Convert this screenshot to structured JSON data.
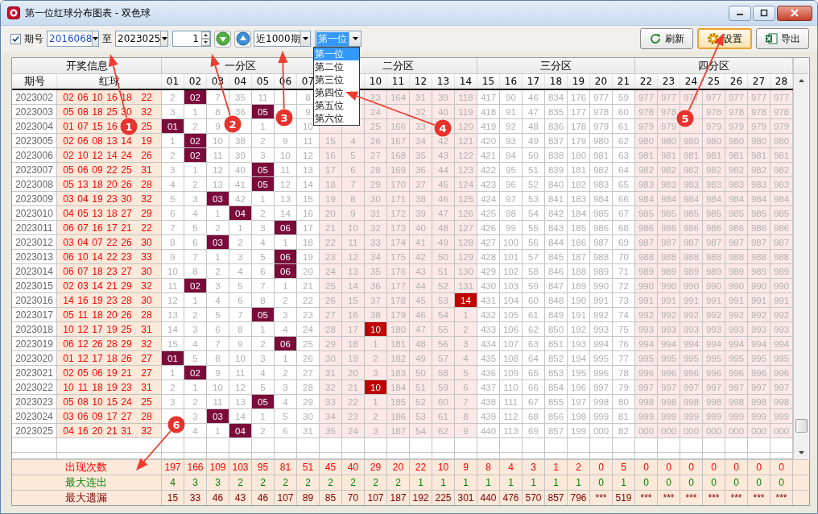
{
  "window": {
    "title": "第一位红球分布图表 - 双色球"
  },
  "toolbar": {
    "period_check": {
      "label": "期号",
      "checked": true
    },
    "from": "2016068",
    "to_label": "至",
    "to": "2023025",
    "step": "1",
    "range": "近1000期",
    "position": {
      "value": "第一位",
      "expanded": true,
      "options": [
        {
          "label": "第一位",
          "selected": true
        },
        {
          "label": "第二位",
          "selected": false
        },
        {
          "label": "第三位",
          "selected": false
        },
        {
          "label": "第四位",
          "selected": false
        },
        {
          "label": "第五位",
          "selected": false
        },
        {
          "label": "第六位",
          "selected": false
        }
      ]
    },
    "buttons": [
      {
        "label": "刷新",
        "kind": "refresh",
        "hovered": false
      },
      {
        "label": "设置",
        "kind": "settings",
        "hovered": true
      },
      {
        "label": "导出",
        "kind": "export",
        "hovered": false
      }
    ]
  },
  "table": {
    "info_header": "开奖信息",
    "issue_header": "期号",
    "red_header": "红球",
    "zones": [
      {
        "label": "一分区",
        "columns": [
          "01",
          "02",
          "03",
          "04",
          "05",
          "06",
          "07"
        ]
      },
      {
        "label": "二分区",
        "columns": [
          null,
          null,
          "10",
          "11",
          "12",
          "13",
          "14"
        ]
      },
      {
        "label": "三分区",
        "columns": [
          "15",
          "16",
          "17",
          "18",
          "19",
          "20",
          "21"
        ]
      },
      {
        "label": "四分区",
        "columns": [
          "22",
          "23",
          "24",
          "25",
          "26",
          "27",
          "28"
        ]
      }
    ],
    "rows": [
      {
        "issue": "2023002",
        "red": [
          "02",
          "06",
          "10",
          "16",
          "18",
          "22"
        ],
        "cells": [
          "2",
          "02",
          "7",
          "35",
          "11",
          null,
          "8",
          null,
          null,
          "23",
          "164",
          "31",
          "39",
          "118",
          "417",
          "90",
          "46",
          "834",
          "176",
          "977",
          "59",
          "977",
          "977",
          "977",
          "977",
          "977",
          "977",
          "977"
        ],
        "hit": [
          false,
          true,
          false,
          false,
          false,
          false,
          false,
          false,
          false,
          false,
          false,
          false,
          false,
          false,
          false,
          false,
          false,
          false,
          false,
          false,
          false,
          false,
          false,
          false,
          false,
          false,
          false,
          false
        ]
      },
      {
        "issue": "2023003",
        "red": [
          "05",
          "08",
          "18",
          "25",
          "30",
          "32"
        ],
        "cells": [
          "3",
          "1",
          "8",
          "36",
          "05",
          null,
          "9",
          null,
          null,
          "24",
          null,
          "32",
          "40",
          "119",
          "418",
          "91",
          "47",
          "835",
          "177",
          "978",
          "60",
          "978",
          "978",
          null,
          "978",
          "978",
          "978",
          "978"
        ],
        "hit": [
          false,
          false,
          false,
          false,
          true,
          false,
          false,
          false,
          false,
          false,
          false,
          false,
          false,
          false,
          false,
          false,
          false,
          false,
          false,
          false,
          false,
          false,
          false,
          false,
          false,
          false,
          false,
          false
        ]
      },
      {
        "issue": "2023004",
        "red": [
          "01",
          "07",
          "15",
          "16",
          "25"
        ],
        "cells": [
          "01",
          "2",
          "9",
          null,
          "1",
          null,
          "10",
          null,
          null,
          "25",
          "166",
          "33",
          null,
          "120",
          "419",
          "92",
          "48",
          "836",
          "178",
          "979",
          "61",
          "979",
          "979",
          null,
          "979",
          "979",
          "979",
          "979"
        ],
        "hit": [
          true,
          false,
          false,
          false,
          false,
          false,
          false,
          false,
          false,
          false,
          false,
          false,
          false,
          false,
          false,
          false,
          false,
          false,
          false,
          false,
          false,
          false,
          false,
          false,
          false,
          false,
          false,
          false
        ]
      },
      {
        "issue": "2023005",
        "red": [
          "02",
          "06",
          "08",
          "13",
          "14",
          "19"
        ],
        "cells": [
          "1",
          "02",
          "10",
          "38",
          "2",
          "9",
          "11",
          "15",
          "4",
          "26",
          "167",
          "34",
          "42",
          "121",
          "420",
          "93",
          "49",
          "837",
          "179",
          "980",
          "62",
          "980",
          "980",
          "980",
          "980",
          "980",
          "980",
          "980"
        ],
        "hit": [
          false,
          true,
          false,
          false,
          false,
          false,
          false,
          false,
          false,
          false,
          false,
          false,
          false,
          false,
          false,
          false,
          false,
          false,
          false,
          false,
          false,
          false,
          false,
          false,
          false,
          false,
          false,
          false
        ]
      },
      {
        "issue": "2023006",
        "red": [
          "02",
          "10",
          "12",
          "14",
          "24",
          "26"
        ],
        "cells": [
          "2",
          "02",
          "11",
          "39",
          "3",
          "10",
          "12",
          "16",
          "5",
          "27",
          "168",
          "35",
          "43",
          "122",
          "421",
          "94",
          "50",
          "838",
          "180",
          "981",
          "63",
          "981",
          "981",
          "981",
          "981",
          "981",
          "981",
          "981"
        ],
        "hit": [
          false,
          true,
          false,
          false,
          false,
          false,
          false,
          false,
          false,
          false,
          false,
          false,
          false,
          false,
          false,
          false,
          false,
          false,
          false,
          false,
          false,
          false,
          false,
          false,
          false,
          false,
          false,
          false
        ]
      },
      {
        "issue": "2023007",
        "red": [
          "05",
          "06",
          "09",
          "22",
          "25",
          "31"
        ],
        "cells": [
          "3",
          "1",
          "12",
          "40",
          "05",
          "11",
          "13",
          "17",
          "6",
          "28",
          "169",
          "36",
          "44",
          "123",
          "422",
          "95",
          "51",
          "839",
          "181",
          "982",
          "64",
          "982",
          "982",
          "982",
          "982",
          "982",
          "982",
          "982"
        ],
        "hit": [
          false,
          false,
          false,
          false,
          true,
          false,
          false,
          false,
          false,
          false,
          false,
          false,
          false,
          false,
          false,
          false,
          false,
          false,
          false,
          false,
          false,
          false,
          false,
          false,
          false,
          false,
          false,
          false
        ]
      },
      {
        "issue": "2023008",
        "red": [
          "05",
          "13",
          "18",
          "20",
          "26",
          "28"
        ],
        "cells": [
          "4",
          "2",
          "13",
          "41",
          "05",
          "12",
          "14",
          "18",
          "7",
          "29",
          "170",
          "37",
          "45",
          "124",
          "423",
          "96",
          "52",
          "840",
          "182",
          "983",
          "65",
          "983",
          "983",
          "983",
          "983",
          "983",
          "983",
          "983"
        ],
        "hit": [
          false,
          false,
          false,
          false,
          true,
          false,
          false,
          false,
          false,
          false,
          false,
          false,
          false,
          false,
          false,
          false,
          false,
          false,
          false,
          false,
          false,
          false,
          false,
          false,
          false,
          false,
          false,
          false
        ]
      },
      {
        "issue": "2023009",
        "red": [
          "03",
          "04",
          "19",
          "23",
          "30",
          "32"
        ],
        "cells": [
          "5",
          "3",
          "03",
          "42",
          "1",
          "13",
          "15",
          "19",
          "8",
          "30",
          "171",
          "38",
          "46",
          "125",
          "424",
          "97",
          "53",
          "841",
          "183",
          "984",
          "66",
          "984",
          "984",
          "984",
          "984",
          "984",
          "984",
          "984"
        ],
        "hit": [
          false,
          false,
          true,
          false,
          false,
          false,
          false,
          false,
          false,
          false,
          false,
          false,
          false,
          false,
          false,
          false,
          false,
          false,
          false,
          false,
          false,
          false,
          false,
          false,
          false,
          false,
          false,
          false
        ]
      },
      {
        "issue": "2023010",
        "red": [
          "04",
          "05",
          "13",
          "18",
          "27",
          "29"
        ],
        "cells": [
          "6",
          "4",
          "1",
          "04",
          "2",
          "14",
          "16",
          "20",
          "9",
          "31",
          "172",
          "39",
          "47",
          "126",
          "425",
          "98",
          "54",
          "842",
          "184",
          "985",
          "67",
          "985",
          "985",
          "985",
          "985",
          "985",
          "985",
          "985"
        ],
        "hit": [
          false,
          false,
          false,
          true,
          false,
          false,
          false,
          false,
          false,
          false,
          false,
          false,
          false,
          false,
          false,
          false,
          false,
          false,
          false,
          false,
          false,
          false,
          false,
          false,
          false,
          false,
          false,
          false
        ]
      },
      {
        "issue": "2023011",
        "red": [
          "06",
          "07",
          "16",
          "17",
          "21",
          "22"
        ],
        "cells": [
          "7",
          "5",
          "2",
          "1",
          "3",
          "06",
          "17",
          "21",
          "10",
          "32",
          "173",
          "40",
          "48",
          "127",
          "426",
          "99",
          "55",
          "843",
          "185",
          "986",
          "68",
          "986",
          "986",
          "986",
          "986",
          "986",
          "986",
          "986"
        ],
        "hit": [
          false,
          false,
          false,
          false,
          false,
          true,
          false,
          false,
          false,
          false,
          false,
          false,
          false,
          false,
          false,
          false,
          false,
          false,
          false,
          false,
          false,
          false,
          false,
          false,
          false,
          false,
          false,
          false
        ]
      },
      {
        "issue": "2023012",
        "red": [
          "03",
          "04",
          "07",
          "22",
          "26",
          "30"
        ],
        "cells": [
          "8",
          "6",
          "03",
          "2",
          "4",
          "1",
          "18",
          "22",
          "11",
          "33",
          "174",
          "41",
          "49",
          "128",
          "427",
          "100",
          "56",
          "844",
          "186",
          "987",
          "69",
          "987",
          "987",
          "987",
          "987",
          "987",
          "987",
          "987"
        ],
        "hit": [
          false,
          false,
          true,
          false,
          false,
          false,
          false,
          false,
          false,
          false,
          false,
          false,
          false,
          false,
          false,
          false,
          false,
          false,
          false,
          false,
          false,
          false,
          false,
          false,
          false,
          false,
          false,
          false
        ]
      },
      {
        "issue": "2023013",
        "red": [
          "06",
          "10",
          "14",
          "22",
          "23",
          "33"
        ],
        "cells": [
          "9",
          "7",
          "1",
          "3",
          "5",
          "06",
          "19",
          "23",
          "12",
          "34",
          "175",
          "42",
          "50",
          "129",
          "428",
          "101",
          "57",
          "845",
          "187",
          "988",
          "70",
          "988",
          "988",
          "988",
          "988",
          "988",
          "988",
          "988"
        ],
        "hit": [
          false,
          false,
          false,
          false,
          false,
          true,
          false,
          false,
          false,
          false,
          false,
          false,
          false,
          false,
          false,
          false,
          false,
          false,
          false,
          false,
          false,
          false,
          false,
          false,
          false,
          false,
          false,
          false
        ]
      },
      {
        "issue": "2023014",
        "red": [
          "06",
          "07",
          "18",
          "23",
          "27",
          "30"
        ],
        "cells": [
          "10",
          "8",
          "2",
          "4",
          "6",
          "06",
          "20",
          "24",
          "13",
          "35",
          "176",
          "43",
          "51",
          "130",
          "429",
          "102",
          "58",
          "846",
          "188",
          "989",
          "71",
          "989",
          "989",
          "989",
          "989",
          "989",
          "989",
          "989"
        ],
        "hit": [
          false,
          false,
          false,
          false,
          false,
          true,
          false,
          false,
          false,
          false,
          false,
          false,
          false,
          false,
          false,
          false,
          false,
          false,
          false,
          false,
          false,
          false,
          false,
          false,
          false,
          false,
          false,
          false
        ]
      },
      {
        "issue": "2023015",
        "red": [
          "02",
          "03",
          "14",
          "21",
          "29",
          "32"
        ],
        "cells": [
          "11",
          "02",
          "3",
          "5",
          "7",
          "1",
          "21",
          "25",
          "14",
          "36",
          "177",
          "44",
          "52",
          "131",
          "430",
          "103",
          "59",
          "847",
          "189",
          "990",
          "72",
          "990",
          "990",
          "990",
          "990",
          "990",
          "990",
          "990"
        ],
        "hit": [
          false,
          true,
          false,
          false,
          false,
          false,
          false,
          false,
          false,
          false,
          false,
          false,
          false,
          false,
          false,
          false,
          false,
          false,
          false,
          false,
          false,
          false,
          false,
          false,
          false,
          false,
          false,
          false
        ]
      },
      {
        "issue": "2023016",
        "red": [
          "14",
          "16",
          "19",
          "23",
          "28",
          "30"
        ],
        "cells": [
          "12",
          "1",
          "4",
          "6",
          "8",
          "2",
          "22",
          "26",
          "15",
          "37",
          "178",
          "45",
          "53",
          "14",
          "431",
          "104",
          "60",
          "848",
          "190",
          "991",
          "73",
          "991",
          "991",
          "991",
          "991",
          "991",
          "991",
          "991"
        ],
        "hit": [
          false,
          false,
          false,
          false,
          false,
          false,
          false,
          false,
          false,
          false,
          false,
          false,
          false,
          true,
          false,
          false,
          false,
          false,
          false,
          false,
          false,
          false,
          false,
          false,
          false,
          false,
          false,
          false
        ]
      },
      {
        "issue": "2023017",
        "red": [
          "05",
          "11",
          "18",
          "20",
          "26",
          "28"
        ],
        "cells": [
          "13",
          "2",
          "5",
          "7",
          "05",
          "3",
          "23",
          "27",
          "16",
          "38",
          "179",
          "46",
          "54",
          "1",
          "432",
          "105",
          "61",
          "849",
          "191",
          "992",
          "74",
          "992",
          "992",
          "992",
          "992",
          "992",
          "992",
          "992"
        ],
        "hit": [
          false,
          false,
          false,
          false,
          true,
          false,
          false,
          false,
          false,
          false,
          false,
          false,
          false,
          false,
          false,
          false,
          false,
          false,
          false,
          false,
          false,
          false,
          false,
          false,
          false,
          false,
          false,
          false
        ]
      },
      {
        "issue": "2023018",
        "red": [
          "10",
          "12",
          "17",
          "19",
          "25",
          "31"
        ],
        "cells": [
          "14",
          "3",
          "6",
          "8",
          "1",
          "4",
          "24",
          "28",
          "17",
          "10",
          "180",
          "47",
          "55",
          "2",
          "433",
          "106",
          "62",
          "850",
          "192",
          "993",
          "75",
          "993",
          "993",
          "993",
          "993",
          "993",
          "993",
          "993"
        ],
        "hit": [
          false,
          false,
          false,
          false,
          false,
          false,
          false,
          false,
          false,
          true,
          false,
          false,
          false,
          false,
          false,
          false,
          false,
          false,
          false,
          false,
          false,
          false,
          false,
          false,
          false,
          false,
          false,
          false
        ]
      },
      {
        "issue": "2023019",
        "red": [
          "06",
          "12",
          "26",
          "28",
          "29",
          "32"
        ],
        "cells": [
          "15",
          "4",
          "7",
          "9",
          "2",
          "06",
          "25",
          "29",
          "18",
          "1",
          "181",
          "48",
          "56",
          "3",
          "434",
          "107",
          "63",
          "851",
          "193",
          "994",
          "76",
          "994",
          "994",
          "994",
          "994",
          "994",
          "994",
          "994"
        ],
        "hit": [
          false,
          false,
          false,
          false,
          false,
          true,
          false,
          false,
          false,
          false,
          false,
          false,
          false,
          false,
          false,
          false,
          false,
          false,
          false,
          false,
          false,
          false,
          false,
          false,
          false,
          false,
          false,
          false
        ]
      },
      {
        "issue": "2023020",
        "red": [
          "01",
          "12",
          "17",
          "18",
          "26",
          "27"
        ],
        "cells": [
          "01",
          "5",
          "8",
          "10",
          "3",
          "1",
          "26",
          "30",
          "19",
          "2",
          "182",
          "49",
          "57",
          "4",
          "435",
          "108",
          "64",
          "852",
          "194",
          "995",
          "77",
          "995",
          "995",
          "995",
          "995",
          "995",
          "995",
          "995"
        ],
        "hit": [
          true,
          false,
          false,
          false,
          false,
          false,
          false,
          false,
          false,
          false,
          false,
          false,
          false,
          false,
          false,
          false,
          false,
          false,
          false,
          false,
          false,
          false,
          false,
          false,
          false,
          false,
          false,
          false
        ]
      },
      {
        "issue": "2023021",
        "red": [
          "02",
          "05",
          "06",
          "19",
          "21",
          "27"
        ],
        "cells": [
          "1",
          "02",
          "9",
          "11",
          "4",
          "2",
          "27",
          "31",
          "20",
          "3",
          "183",
          "50",
          "58",
          "5",
          "436",
          "109",
          "65",
          "853",
          "195",
          "996",
          "78",
          "996",
          "996",
          "996",
          "996",
          "996",
          "996",
          "996"
        ],
        "hit": [
          false,
          true,
          false,
          false,
          false,
          false,
          false,
          false,
          false,
          false,
          false,
          false,
          false,
          false,
          false,
          false,
          false,
          false,
          false,
          false,
          false,
          false,
          false,
          false,
          false,
          false,
          false,
          false
        ]
      },
      {
        "issue": "2023022",
        "red": [
          "10",
          "11",
          "18",
          "19",
          "23",
          "31"
        ],
        "cells": [
          "2",
          "1",
          "10",
          "12",
          "5",
          "3",
          "28",
          "32",
          "21",
          "10",
          "184",
          "51",
          "59",
          "6",
          "437",
          "110",
          "66",
          "854",
          "196",
          "997",
          "79",
          "997",
          "997",
          "997",
          "997",
          "997",
          "997",
          "997"
        ],
        "hit": [
          false,
          false,
          false,
          false,
          false,
          false,
          false,
          false,
          false,
          true,
          false,
          false,
          false,
          false,
          false,
          false,
          false,
          false,
          false,
          false,
          false,
          false,
          false,
          false,
          false,
          false,
          false,
          false
        ]
      },
      {
        "issue": "2023023",
        "red": [
          "05",
          "08",
          "10",
          "15",
          "24",
          "25"
        ],
        "cells": [
          "3",
          "2",
          "11",
          "13",
          "05",
          "4",
          "29",
          "33",
          "22",
          "1",
          "185",
          "52",
          "60",
          "7",
          "438",
          "111",
          "67",
          "855",
          "197",
          "998",
          "80",
          "998",
          "998",
          "998",
          "998",
          "998",
          "998",
          "998"
        ],
        "hit": [
          false,
          false,
          false,
          false,
          true,
          false,
          false,
          false,
          false,
          false,
          false,
          false,
          false,
          false,
          false,
          false,
          false,
          false,
          false,
          false,
          false,
          false,
          false,
          false,
          false,
          false,
          false,
          false
        ]
      },
      {
        "issue": "2023024",
        "red": [
          "03",
          "06",
          "09",
          "17",
          "27",
          "28"
        ],
        "cells": [
          null,
          "3",
          "03",
          "14",
          "1",
          "5",
          "30",
          "34",
          "23",
          "2",
          "186",
          "53",
          "61",
          "8",
          "439",
          "112",
          "68",
          "856",
          "198",
          "999",
          "81",
          "999",
          "999",
          "999",
          "999",
          "999",
          "999",
          "999"
        ],
        "hit": [
          false,
          false,
          true,
          false,
          false,
          false,
          false,
          false,
          false,
          false,
          false,
          false,
          false,
          false,
          false,
          false,
          false,
          false,
          false,
          false,
          false,
          false,
          false,
          false,
          false,
          false,
          false,
          false
        ]
      },
      {
        "issue": "2023025",
        "red": [
          "04",
          "16",
          "20",
          "21",
          "31",
          "32"
        ],
        "cells": [
          null,
          "4",
          "1",
          "04",
          "2",
          "6",
          "31",
          "35",
          "24",
          "3",
          "187",
          "54",
          "62",
          "9",
          "440",
          "113",
          "69",
          "857",
          "199",
          "000",
          "82",
          "000",
          "000",
          "000",
          "000",
          "000",
          "000",
          "000"
        ],
        "hit": [
          false,
          false,
          false,
          true,
          false,
          false,
          false,
          false,
          false,
          false,
          false,
          false,
          false,
          false,
          false,
          false,
          false,
          false,
          false,
          false,
          false,
          false,
          false,
          false,
          false,
          false,
          false,
          false
        ]
      }
    ],
    "footer": [
      {
        "label": "出现次数",
        "kind": "count",
        "values": [
          "197",
          "166",
          "109",
          "103",
          "95",
          "81",
          "51",
          "45",
          "40",
          "29",
          "20",
          "22",
          "10",
          "9",
          "8",
          "4",
          "3",
          "1",
          "2",
          "0",
          "5",
          "0",
          "0",
          "0",
          "0",
          "0",
          "0",
          "0"
        ]
      },
      {
        "label": "最大连出",
        "kind": "streak",
        "values": [
          "4",
          "3",
          "3",
          "2",
          "2",
          "2",
          "2",
          "2",
          "2",
          "2",
          "2",
          "1",
          "1",
          "1",
          "1",
          "1",
          "1",
          "1",
          "1",
          "0",
          "1",
          "0",
          "0",
          "0",
          "0",
          "0",
          "0",
          "0"
        ]
      },
      {
        "label": "最大遗漏",
        "kind": "omission",
        "values": [
          "15",
          "33",
          "46",
          "43",
          "46",
          "107",
          "89",
          "85",
          "70",
          "107",
          "187",
          "192",
          "225",
          "301",
          "440",
          "476",
          "570",
          "857",
          "796",
          "***",
          "519",
          "***",
          "***",
          "***",
          "***",
          "***",
          "***",
          "***"
        ]
      }
    ]
  },
  "annotations": [
    {
      "number": "1"
    },
    {
      "number": "2"
    },
    {
      "number": "3"
    },
    {
      "number": "4"
    },
    {
      "number": "5"
    },
    {
      "number": "6"
    }
  ]
}
